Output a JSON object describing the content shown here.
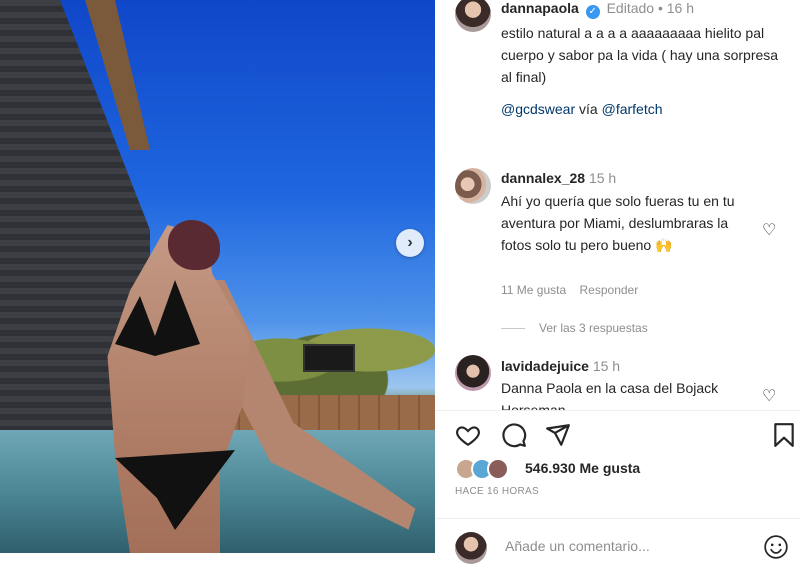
{
  "post": {
    "author": "dannapaola",
    "edited_label": "Editado",
    "time": "16 h",
    "caption": "estilo natural a a a a aaaaaaaaa hielito pal cuerpo y sabor pa la vida ( hay una sorpresa al final)",
    "mention1": "@gcdswear",
    "via": "vía",
    "mention2": "@farfetch"
  },
  "comments": [
    {
      "username": "dannalex_28",
      "time": "15 h",
      "text": "Ahí yo quería que solo fueras tu en tu aventura por Miami, deslumbraras la fotos solo tu pero bueno 🙌",
      "likes": "11 Me gusta",
      "reply": "Responder",
      "view_replies": "Ver las 3 respuestas"
    },
    {
      "username": "lavidadejuice",
      "time": "15 h",
      "text": "Danna Paola en la casa del Bojack Horseman"
    }
  ],
  "footer": {
    "likes_count": "546.930 Me gusta",
    "posted_ago": "HACE 16 HORAS",
    "comment_placeholder": "Añade un comentario..."
  },
  "icons": {
    "like": "heart-icon",
    "comment": "comment-icon",
    "share": "send-icon",
    "save": "bookmark-icon",
    "next": "chevron-right-icon",
    "emoji": "emoji-icon"
  },
  "colors": {
    "verified": "#3897f0",
    "link": "#00376b",
    "muted": "#8e8e8e"
  }
}
